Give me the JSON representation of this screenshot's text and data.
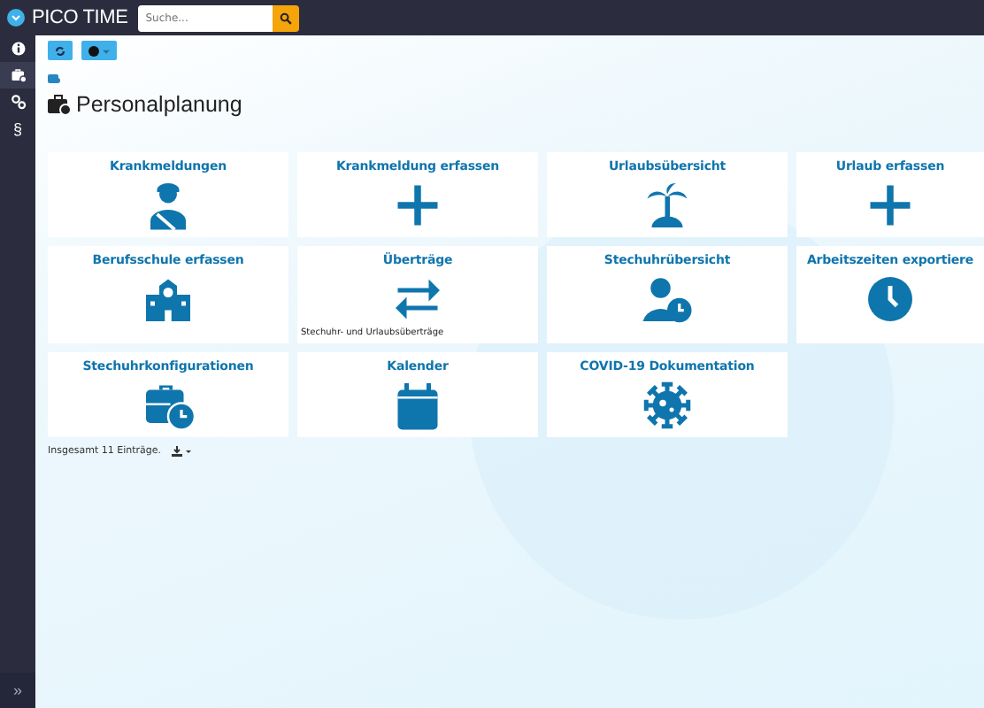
{
  "header": {
    "logo": "PICO TIME",
    "search": {
      "placeholder": "Suche..."
    }
  },
  "sidebar": {
    "items": [
      {
        "kind": "info",
        "selected": false
      },
      {
        "kind": "briefcase",
        "selected": true
      },
      {
        "kind": "gears",
        "selected": false
      },
      {
        "kind": "text",
        "label": "§",
        "selected": false
      }
    ],
    "expand": "»"
  },
  "page": {
    "title": "Personalplanung"
  },
  "tiles": [
    {
      "title": "Krankmeldungen",
      "kind": "sick"
    },
    {
      "title": "Krankmeldung erfassen",
      "kind": "plus"
    },
    {
      "title": "Urlaubsübersicht",
      "kind": "palm"
    },
    {
      "title": "Urlaub erfassen",
      "kind": "plus"
    },
    {
      "title": "Berufsschule erfassen",
      "kind": "school"
    },
    {
      "title": "Überträge",
      "kind": "transfer",
      "subtitle": "Stechuhr- und Urlaubsüberträge"
    },
    {
      "title": "Stechuhrübersicht",
      "kind": "person-clock"
    },
    {
      "title": "Arbeitszeiten exportiere",
      "kind": "clock"
    },
    {
      "title": "Stechuhrkonfigurationen",
      "kind": "briefcase-clock"
    },
    {
      "title": "Kalender",
      "kind": "calendar"
    },
    {
      "title": "COVID-19 Dokumentation",
      "kind": "virus"
    }
  ],
  "footer": {
    "count": "Insgesamt 11 Einträge."
  }
}
